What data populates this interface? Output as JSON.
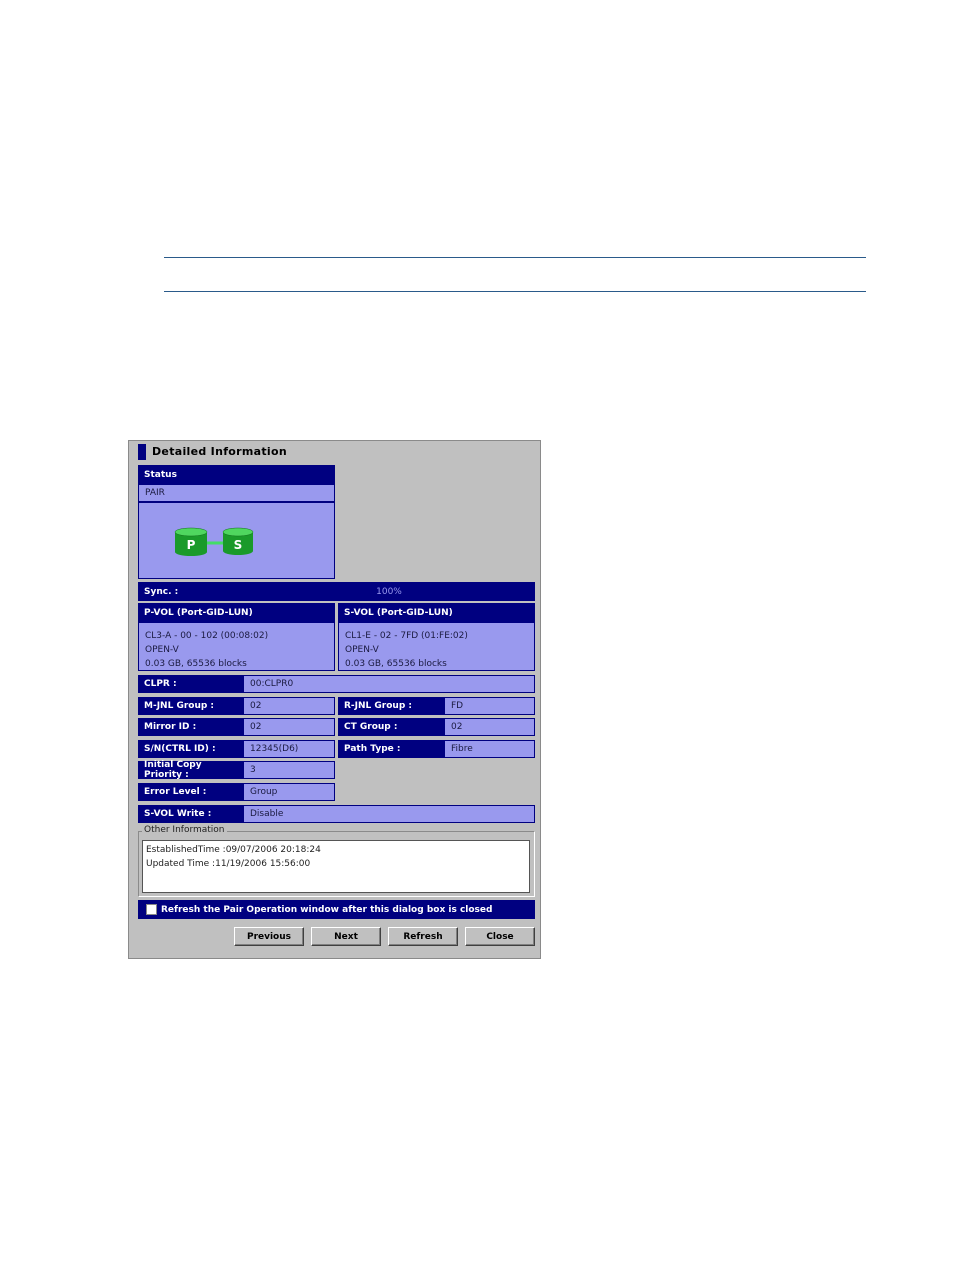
{
  "dialog": {
    "title": "Detailed Information",
    "status": {
      "header": "Status",
      "value": "PAIR",
      "p_label": "P",
      "s_label": "S"
    },
    "sync": {
      "label": "Sync. :",
      "value": "100%",
      "fraction": 1.0
    },
    "pvol": {
      "header": "P-VOL (Port-GID-LUN)",
      "lines": [
        "CL3-A - 00 - 102 (00:08:02)",
        "OPEN-V",
        "0.03 GB, 65536 blocks"
      ]
    },
    "svol": {
      "header": "S-VOL (Port-GID-LUN)",
      "lines": [
        "CL1-E - 02 - 7FD (01:FE:02)",
        "OPEN-V",
        "0.03 GB, 65536 blocks"
      ]
    },
    "fields": {
      "clpr": {
        "label": "CLPR :",
        "value": "00:CLPR0"
      },
      "mjnl": {
        "label": "M-JNL Group :",
        "value": "02"
      },
      "rjnl": {
        "label": "R-JNL Group :",
        "value": "FD"
      },
      "mirror": {
        "label": "Mirror ID :",
        "value": "02"
      },
      "ctgroup": {
        "label": "CT Group :",
        "value": "02"
      },
      "sn": {
        "label": "S/N(CTRL ID) :",
        "value": "12345(D6)"
      },
      "pathtype": {
        "label": "Path Type :",
        "value": "Fibre"
      },
      "priority": {
        "label": "Initial Copy Priority :",
        "value": "3"
      },
      "errorlevel": {
        "label": "Error Level :",
        "value": "Group"
      },
      "svolwrite": {
        "label": "S-VOL Write :",
        "value": "Disable"
      }
    },
    "other": {
      "legend": "Other Information",
      "lines": [
        "EstablishedTime :09/07/2006 20:18:24",
        "Updated Time :11/19/2006 15:56:00"
      ]
    },
    "refresh_check": {
      "label": "Refresh the Pair Operation window after this dialog box is closed",
      "checked": false
    },
    "buttons": {
      "previous": "Previous",
      "next": "Next",
      "refresh": "Refresh",
      "close": "Close"
    }
  }
}
